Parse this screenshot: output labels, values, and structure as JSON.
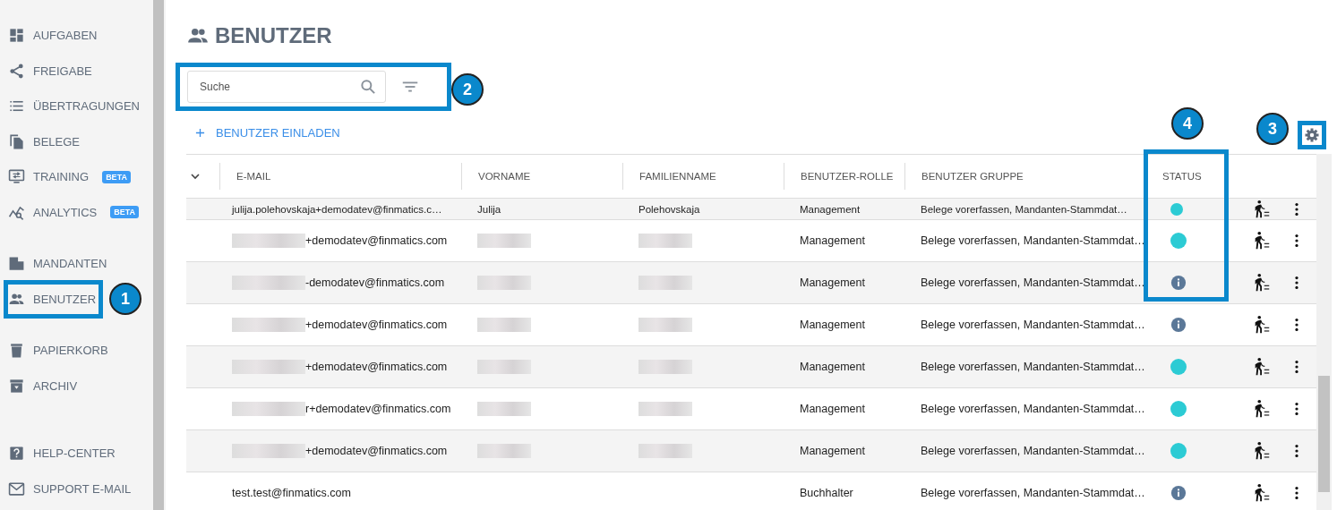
{
  "sidebar": {
    "groups": [
      {
        "items": [
          {
            "label": "AUFGABEN"
          },
          {
            "label": "FREIGABE"
          },
          {
            "label": "ÜBERTRAGUNGEN"
          },
          {
            "label": "BELEGE"
          },
          {
            "label": "TRAINING",
            "badge": "BETA"
          },
          {
            "label": "ANALYTICS",
            "badge": "BETA"
          }
        ]
      },
      {
        "items": [
          {
            "label": "MANDANTEN"
          },
          {
            "label": "BENUTZER"
          }
        ]
      },
      {
        "items": [
          {
            "label": "PAPIERKORB"
          },
          {
            "label": "ARCHIV"
          }
        ]
      },
      {
        "items": [
          {
            "label": "HELP-CENTER"
          },
          {
            "label": "SUPPORT E-MAIL"
          }
        ]
      }
    ]
  },
  "page": {
    "title": "BENUTZER",
    "search": {
      "placeholder": "Suche"
    },
    "invite_link": "BENUTZER EINLADEN"
  },
  "table": {
    "columns": [
      "E-MAIL",
      "VORNAME",
      "FAMILIENNAME",
      "BENUTZER-ROLLE",
      "BENUTZER GRUPPE",
      "STATUS"
    ],
    "rows": [
      {
        "email": "julija.polehovskaja+demodatev@finmatics.c…",
        "email_blurred": false,
        "first_name": "Julija",
        "last_name": "Polehovskaja",
        "names_blurred": false,
        "role": "Management",
        "group": "Belege vorerfassen, Mandanten-Stammdat…",
        "kind": "active",
        "partial": true
      },
      {
        "email": "+demodatev@finmatics.com",
        "email_blurred": true,
        "names_blurred": true,
        "role": "Management",
        "group": "Belege vorerfassen, Mandanten-Stammdat…",
        "kind": "active",
        "partial": false
      },
      {
        "email": "-demodatev@finmatics.com",
        "email_blurred": true,
        "names_blurred": true,
        "role": "Management",
        "group": "Belege vorerfassen, Mandanten-Stammdat…",
        "kind": "info",
        "partial": false
      },
      {
        "email": "+demodatev@finmatics.com",
        "email_blurred": true,
        "names_blurred": true,
        "role": "Management",
        "group": "Belege vorerfassen, Mandanten-Stammdat…",
        "kind": "info",
        "partial": false
      },
      {
        "email": "+demodatev@finmatics.com",
        "email_blurred": true,
        "names_blurred": true,
        "role": "Management",
        "group": "Belege vorerfassen, Mandanten-Stammdat…",
        "kind": "active",
        "partial": false
      },
      {
        "email": "r+demodatev@finmatics.com",
        "email_blurred": true,
        "names_blurred": true,
        "role": "Management",
        "group": "Belege vorerfassen, Mandanten-Stammdat…",
        "kind": "active",
        "partial": false
      },
      {
        "email": "+demodatev@finmatics.com",
        "email_blurred": true,
        "names_blurred": true,
        "role": "Management",
        "group": "Belege vorerfassen, Mandanten-Stammdat…",
        "kind": "active",
        "partial": false
      },
      {
        "email": "test.test@finmatics.com",
        "email_blurred": false,
        "names_blurred": false,
        "role": "Buchhalter",
        "group": "Belege vorerfassen, Mandanten-Stammdat…",
        "kind": "info",
        "partial": false
      }
    ]
  },
  "callouts": [
    {
      "label": "1"
    },
    {
      "label": "2"
    },
    {
      "label": "3"
    },
    {
      "label": "4"
    }
  ]
}
